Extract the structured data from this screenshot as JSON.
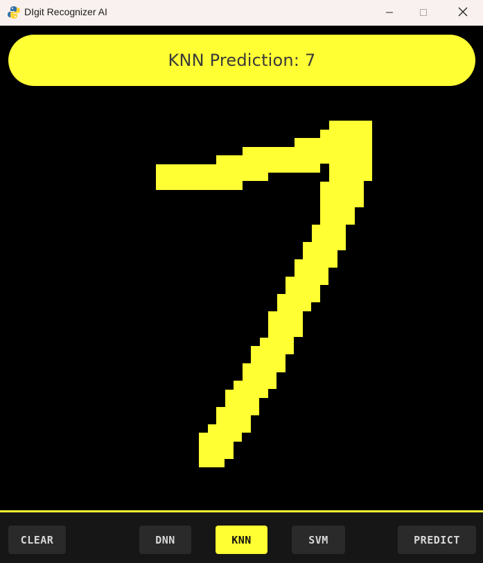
{
  "window": {
    "title": "DIgit Recognizer AI",
    "icon": "python-snake-icon",
    "controls": [
      "minimize-icon",
      "maximize-icon",
      "close-icon"
    ]
  },
  "prediction": {
    "text": "KNN Prediction: 7",
    "model": "KNN",
    "digit": "7"
  },
  "canvas": {
    "drawn_digit": "7",
    "stroke_color": "#ffff33",
    "background_color": "#000000"
  },
  "toolbar": {
    "clear_label": "CLEAR",
    "dnn_label": "DNN",
    "knn_label": "KNN",
    "svm_label": "SVM",
    "predict_label": "PREDICT",
    "active_model": "KNN"
  },
  "colors": {
    "accent": "#ffff33",
    "button_bg": "#2a2a2a",
    "toolbar_bg": "#161616",
    "titlebar_bg": "#f9f1ef"
  }
}
